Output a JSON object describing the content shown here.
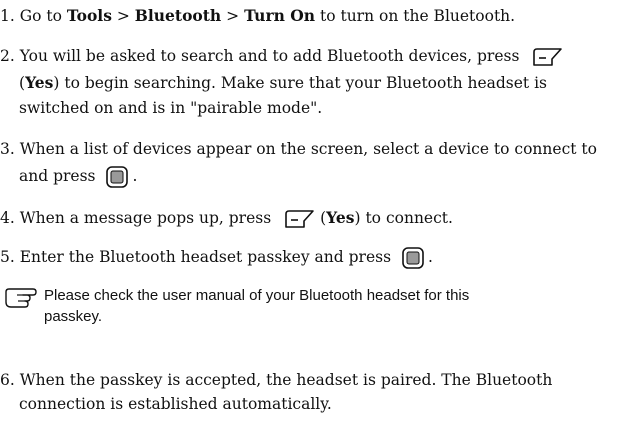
{
  "steps": [
    {
      "number": "1.",
      "text_a": "Go to",
      "b1": "Tools",
      "sep1": ">",
      "b2": "Bluetooth",
      "sep2": ">",
      "b3": "Turn On",
      "text_b": "to turn on the Bluetooth."
    },
    {
      "number": "2.",
      "line1": "You will be asked to search and to add Bluetooth devices, press",
      "paren_open": "(",
      "yes": "Yes",
      "paren_close_rest": ") to begin searching. Make sure that your Bluetooth headset is",
      "line3": "switched on and is in \"pairable mode\"."
    },
    {
      "number": "3.",
      "line1": "When a list of devices appear on the screen, select a device to connect to",
      "line2": "and press",
      "end": "."
    },
    {
      "number": "4.",
      "text_a": "When a message pops up, press",
      "paren_open": "(",
      "yes": "Yes",
      "text_b": ") to connect."
    },
    {
      "number": "5.",
      "text_a": "Enter the Bluetooth headset passkey and press",
      "end": "."
    },
    {
      "number": "6.",
      "line1": "When the passkey is accepted, the headset is paired. The Bluetooth",
      "line2": "connection is established automatically."
    }
  ],
  "note": {
    "icon": "hand-pointing-icon",
    "line1": "Please check the user manual of your Bluetooth headset for this",
    "line2": "passkey."
  },
  "icons": {
    "softkey": "left-softkey-icon",
    "ok": "ok-center-key-icon"
  }
}
